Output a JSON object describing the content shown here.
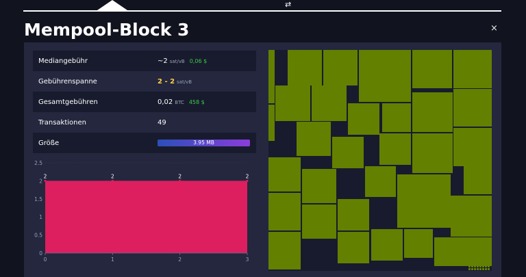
{
  "topbar": {
    "swap_icon": "⇄"
  },
  "title": "Mempool-Block 3",
  "close_icon": "×",
  "stats": {
    "median_fee": {
      "label": "Mediangebühr",
      "value": "~2",
      "unit": "sat/vB",
      "fiat": "0,06 $"
    },
    "fee_span": {
      "label": "Gebührenspanne",
      "value": "2 - 2",
      "unit": "sat/vB"
    },
    "total_fees": {
      "label": "Gesamtgebühren",
      "value": "0,02",
      "unit": "BTC",
      "fiat": "458 $"
    },
    "transactions": {
      "label": "Transaktionen",
      "value": "49"
    },
    "size": {
      "label": "Größe",
      "value": "3.95 MB",
      "fill_fraction": 1.0
    }
  },
  "chart_data": {
    "type": "area",
    "x": [
      0,
      1,
      2,
      3
    ],
    "values": [
      2,
      2,
      2,
      2
    ],
    "data_labels": [
      "2",
      "2",
      "2",
      "2"
    ],
    "ylim": [
      0,
      2.5
    ],
    "yticks": [
      "0",
      "0.5",
      "1",
      "1.5",
      "2",
      "2.5"
    ],
    "xticks": [
      "0",
      "1",
      "2",
      "3"
    ],
    "color": "#dd1e5f"
  },
  "colors": {
    "tile": "#638000",
    "panel": "#24273e",
    "background": "#11131f"
  }
}
